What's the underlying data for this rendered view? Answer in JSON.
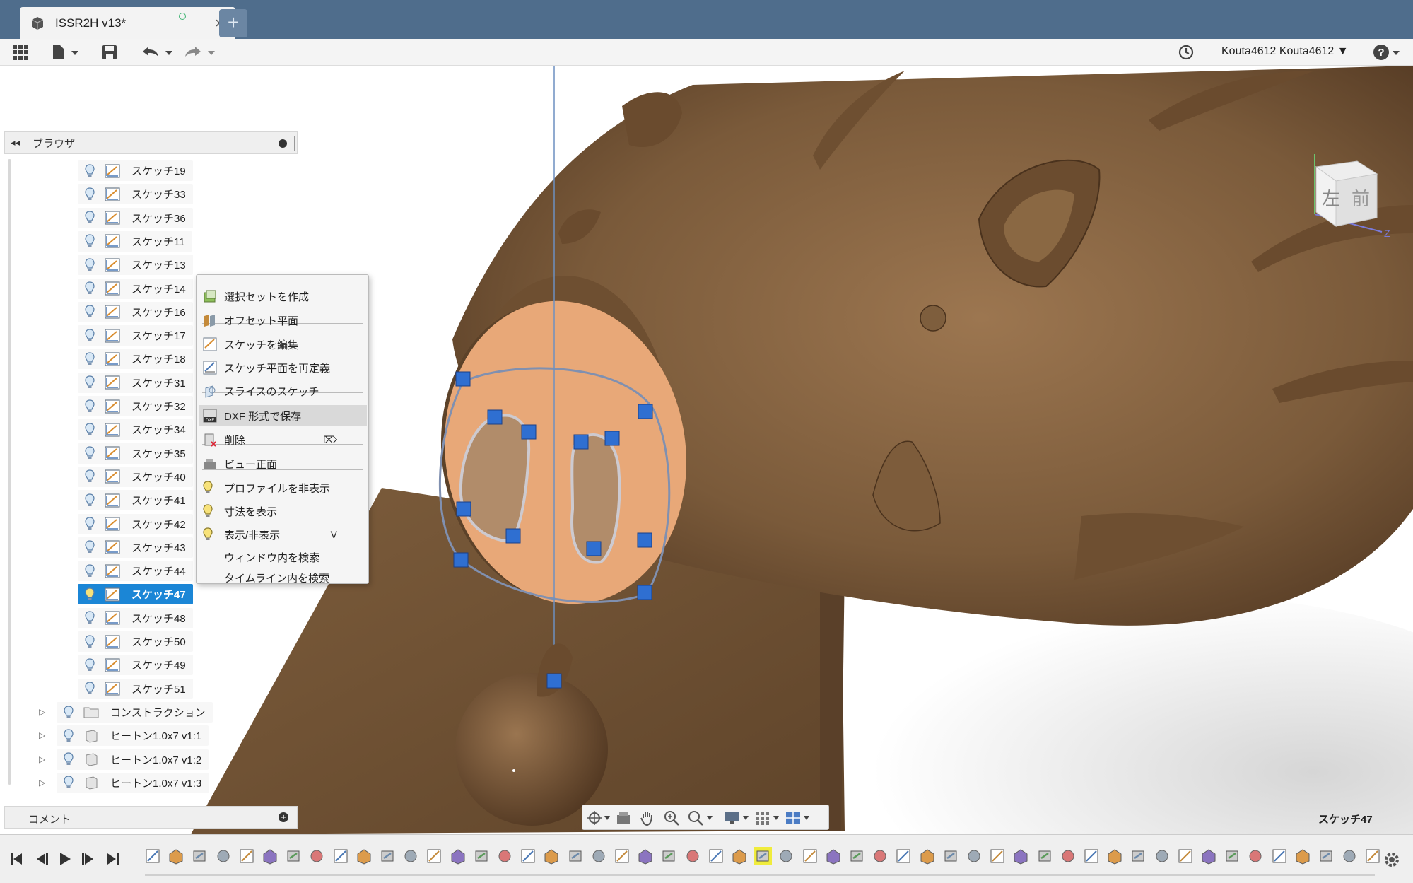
{
  "document": {
    "tab_title": "ISSR2H v13*",
    "close_glyph": "×",
    "new_tab_glyph": "+"
  },
  "header": {
    "user_name": "Kouta4612 Kouta4612 ▼",
    "help_label": "?"
  },
  "browser": {
    "title": "ブラウザ",
    "collapse_glyph": "◂◂",
    "sketches": [
      {
        "label": "スケッチ19"
      },
      {
        "label": "スケッチ33"
      },
      {
        "label": "スケッチ36"
      },
      {
        "label": "スケッチ11"
      },
      {
        "label": "スケッチ13"
      },
      {
        "label": "スケッチ14"
      },
      {
        "label": "スケッチ16"
      },
      {
        "label": "スケッチ17"
      },
      {
        "label": "スケッチ18"
      },
      {
        "label": "スケッチ31"
      },
      {
        "label": "スケッチ32"
      },
      {
        "label": "スケッチ34"
      },
      {
        "label": "スケッチ35"
      },
      {
        "label": "スケッチ40"
      },
      {
        "label": "スケッチ41"
      },
      {
        "label": "スケッチ42"
      },
      {
        "label": "スケッチ43"
      },
      {
        "label": "スケッチ44"
      },
      {
        "label": "スケッチ47",
        "selected": true
      },
      {
        "label": "スケッチ48"
      },
      {
        "label": "スケッチ50"
      },
      {
        "label": "スケッチ49"
      },
      {
        "label": "スケッチ51"
      }
    ],
    "folders": [
      {
        "label": "コンストラクション"
      },
      {
        "label": "ヒートン1.0x7 v1:1"
      },
      {
        "label": "ヒートン1.0x7 v1:2"
      },
      {
        "label": "ヒートン1.0x7 v1:3"
      }
    ]
  },
  "comments": {
    "title": "コメント",
    "add_glyph": "+"
  },
  "context_menu": {
    "items": [
      {
        "label": "選択セットを作成",
        "icon": "selection-set-icon"
      },
      {
        "label": "オフセット平面",
        "icon": "offset-plane-icon"
      },
      {
        "label": "スケッチを編集",
        "icon": "edit-sketch-icon"
      },
      {
        "label": "スケッチ平面を再定義",
        "icon": "redefine-plane-icon"
      },
      {
        "label": "スライスのスケッチ",
        "icon": "slice-sketch-icon"
      },
      {
        "label": "DXF 形式で保存",
        "icon": "dxf-icon",
        "highlighted": true
      },
      {
        "label": "削除",
        "icon": "delete-icon",
        "shortcut": "⌦"
      },
      {
        "label": "ビュー正面",
        "icon": "look-at-icon"
      },
      {
        "label": "プロファイルを非表示",
        "icon": "bulb-icon"
      },
      {
        "label": "寸法を表示",
        "icon": "bulb-icon"
      },
      {
        "label": "表示/非表示",
        "icon": "bulb-icon",
        "shortcut": "V"
      },
      {
        "label": "ウィンドウ内を検索",
        "icon": ""
      },
      {
        "label": "タイムライン内を検索",
        "icon": ""
      }
    ]
  },
  "viewcube": {
    "left_face": "左",
    "front_face": "前",
    "z_label": "Z"
  },
  "status": {
    "active_sketch": "スケッチ47"
  },
  "colors": {
    "title_bar": "#4f6d8c",
    "selection": "#1b86d6",
    "model_brown": "#7a5a3a",
    "profile_fill": "#e8a878",
    "sketch_point": "#2f6fd1"
  }
}
